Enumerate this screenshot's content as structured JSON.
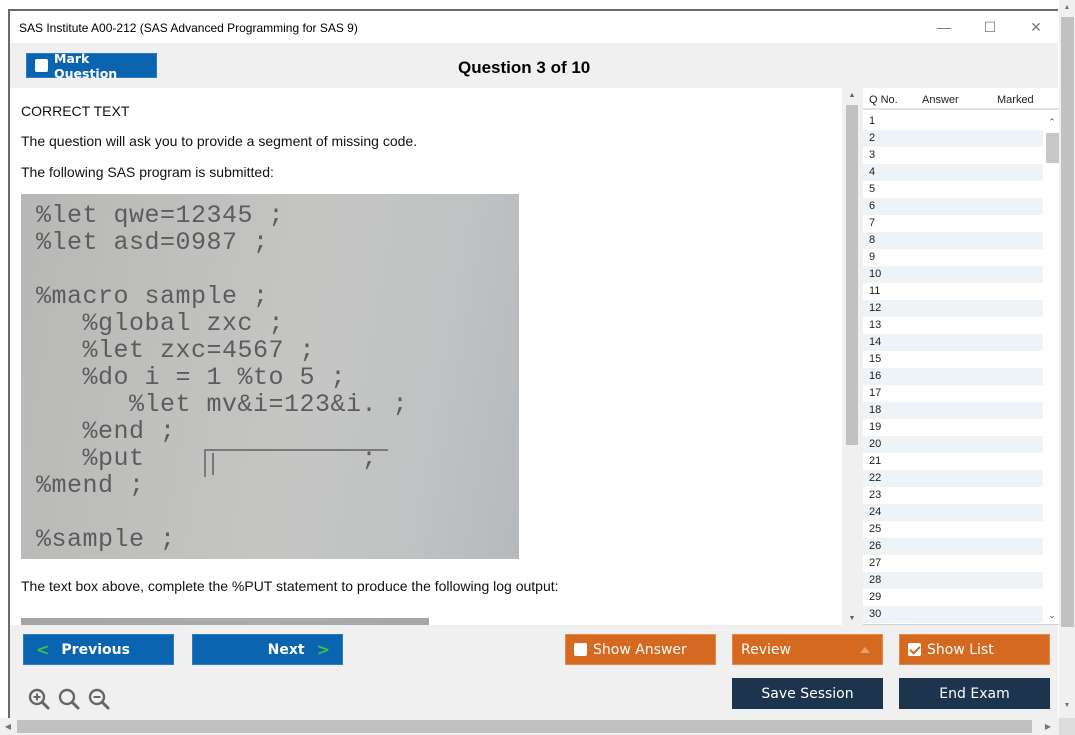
{
  "window": {
    "title": "SAS Institute A00-212 (SAS Advanced Programming for SAS 9)",
    "controls": {
      "minimize": "—",
      "maximize": "☐",
      "close": "✕"
    }
  },
  "header": {
    "mark_question_label": "Mark Question",
    "mark_question_checked": false,
    "question_title": "Question 3 of 10"
  },
  "question": {
    "type_label": "CORRECT TEXT",
    "intro": "The question will ask you to provide a segment of missing code.",
    "program_intro": "The following SAS program is submitted:",
    "code_lines": [
      "%let qwe=12345 ;",
      "%let asd=0987 ;",
      "",
      "%macro sample ;",
      "   %global zxc ;",
      "   %let zxc=4567 ;",
      "   %do i = 1 %to 5 ;",
      "      %let mv&i=123&i. ;",
      "   %end ;",
      "   %put              ;",
      "%mend ;",
      "",
      "%sample ;"
    ],
    "instruction": "The text box above, complete the %PUT statement to produce the following log output:"
  },
  "question_list": {
    "columns": [
      "Q No.",
      "Answer",
      "Marked"
    ],
    "rows": [
      "1",
      "2",
      "3",
      "4",
      "5",
      "6",
      "7",
      "8",
      "9",
      "10",
      "11",
      "12",
      "13",
      "14",
      "15",
      "16",
      "17",
      "18",
      "19",
      "20",
      "21",
      "22",
      "23",
      "24",
      "25",
      "26",
      "27",
      "28",
      "29",
      "30"
    ]
  },
  "footer": {
    "previous_label": "Previous",
    "next_label": "Next",
    "show_answer_label": "Show Answer",
    "show_answer_checked": false,
    "review_label": "Review",
    "show_list_label": "Show List",
    "show_list_checked": true,
    "save_session_label": "Save Session",
    "end_exam_label": "End Exam",
    "zoom_icons": [
      "zoom-in-icon",
      "zoom-reset-icon",
      "zoom-out-icon"
    ]
  },
  "colors": {
    "primary_blue": "#0b64b0",
    "accent_orange": "#d4691f",
    "navy": "#1c344d",
    "chevron_green": "#3ec43e"
  }
}
